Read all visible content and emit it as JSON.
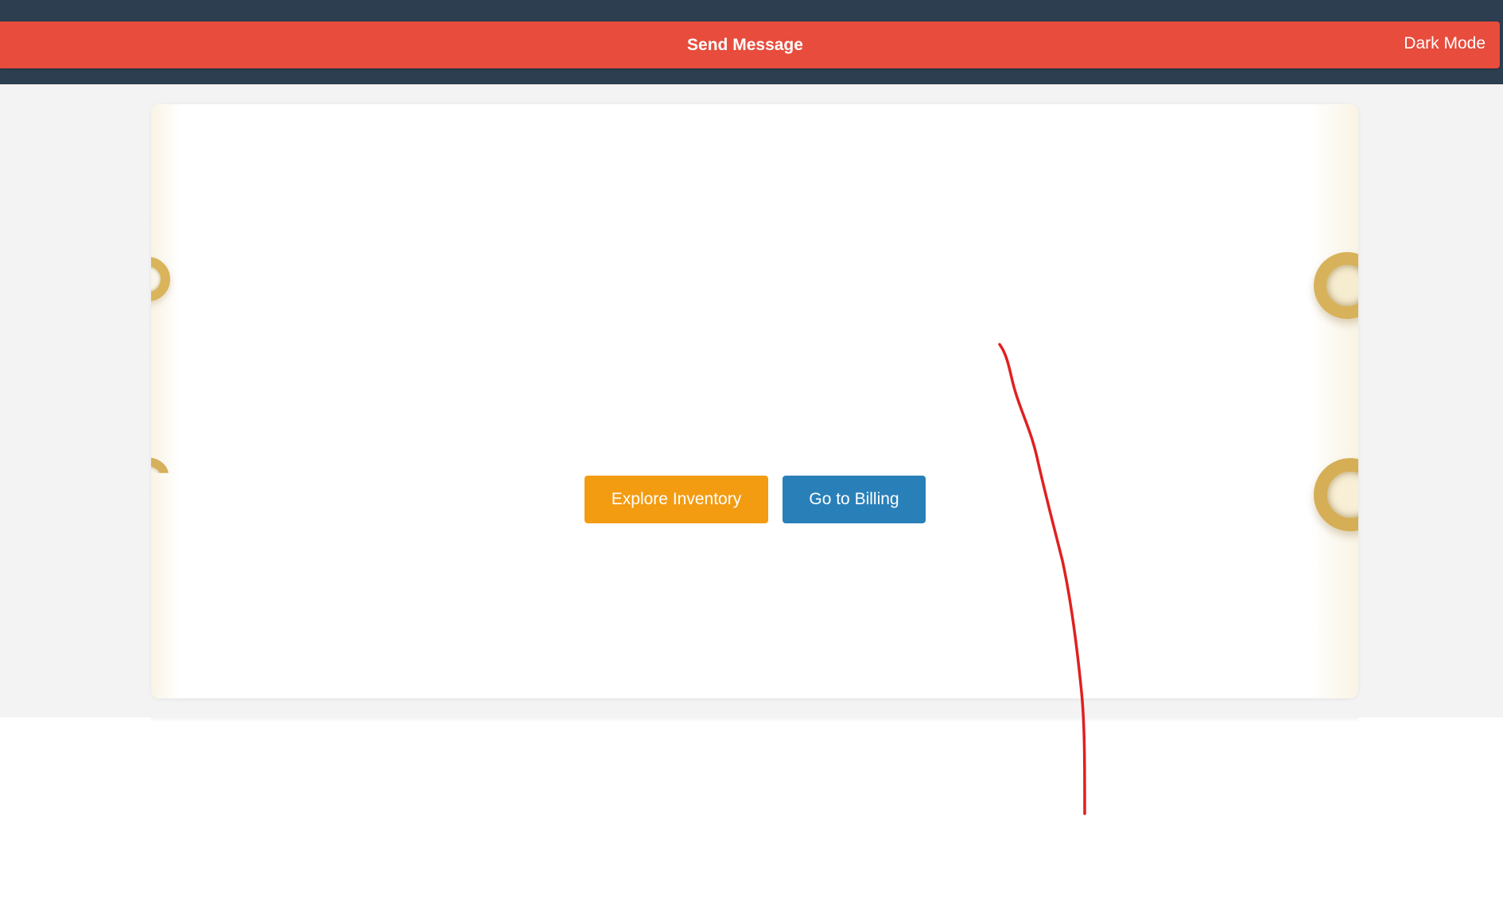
{
  "header": {
    "send_message_label": "Send Message",
    "dark_mode_label": "Dark Mode"
  },
  "card": {
    "buttons": {
      "explore_label": "Explore Inventory",
      "billing_label": "Go to Billing"
    }
  },
  "colors": {
    "top_strip": "#2c3e50",
    "message_bar": "#e74c3c",
    "explore_button": "#f39c12",
    "billing_button": "#2980b9",
    "annotation_stroke": "#e02020"
  },
  "icons": {
    "card_background": "brass-eyelet-rings-image"
  }
}
